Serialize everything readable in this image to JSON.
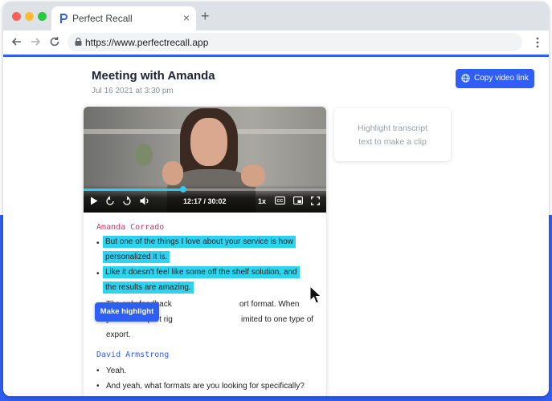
{
  "browser": {
    "tab_title": "Perfect Recall",
    "tab_close": "×",
    "new_tab": "+",
    "url": "https://www.perfectrecall.app"
  },
  "meeting": {
    "title": "Meeting with Amanda",
    "date": "Jul 16 2021 at 3:30 pm",
    "copy_button": "Copy video link"
  },
  "player": {
    "time": "12:17 / 30:02",
    "speed": "1x",
    "progress": 0.41,
    "cc": "CC"
  },
  "side_panel": {
    "hint_line1": "Highlight transcript",
    "hint_line2": "text to make a clip"
  },
  "transcript": {
    "speaker1": "Amanda Corrado",
    "s1_b1_l1": "But one of the things I love about your service is how",
    "s1_b1_l2": "personalized it is.",
    "s1_b2_l1": "Like it doesn't feel like some off the shelf solution, and",
    "s1_b2_l2": "the results are amazing.",
    "s1_b3_l1_a": "The only feedback",
    "s1_b3_l1_b": "ort format. When",
    "s1_b3_l2_a": "you click export rig",
    "s1_b3_l2_b": "imited to one type of",
    "s1_b3_l3": "export.",
    "speaker2": "David Armstrong",
    "s2_b1": "Yeah.",
    "s2_b2": "And yeah, what formats are you looking for specifically?",
    "bullet": "•"
  },
  "tooltip": "Make highlight",
  "colors": {
    "accent": "#2f5ef5",
    "highlight": "#2dd4f0",
    "speaker1": "#d6336c",
    "speaker2": "#2f5ef5"
  },
  "icons": [
    "perfect-recall-logo-icon",
    "back-arrow-icon",
    "forward-arrow-icon",
    "reload-icon",
    "lock-icon",
    "kebab-menu-icon",
    "globe-icon",
    "play-icon",
    "rewind-icon",
    "forward-icon",
    "volume-icon",
    "captions-icon",
    "picture-in-picture-icon",
    "fullscreen-icon",
    "mouse-cursor-icon"
  ]
}
